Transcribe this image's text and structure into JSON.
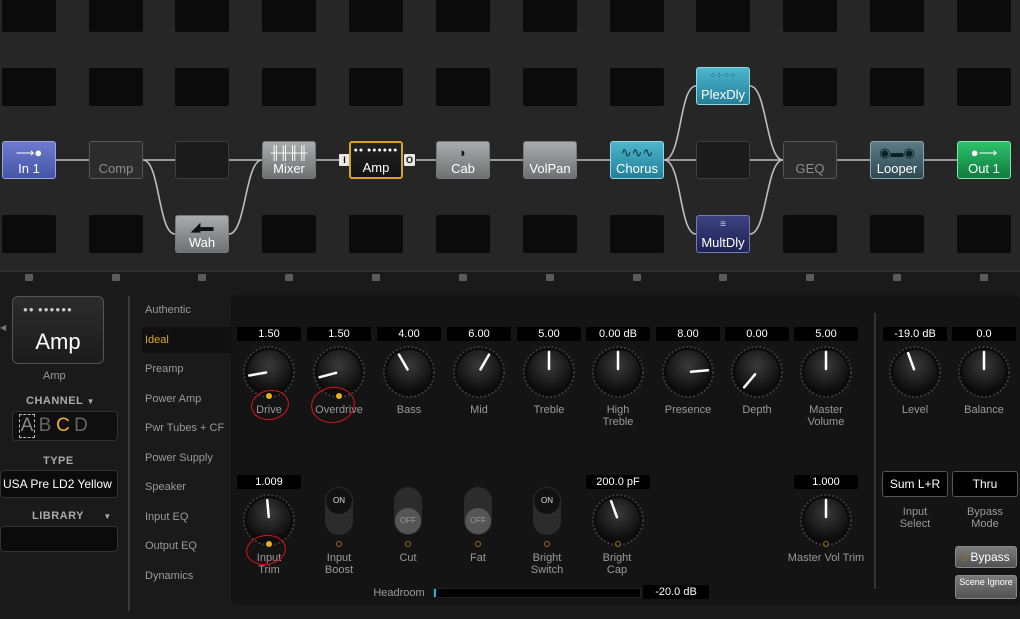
{
  "grid": {
    "blocks": {
      "in": {
        "label": "In 1",
        "icon": "arrow-right-icon"
      },
      "comp": {
        "label": "Comp"
      },
      "wah": {
        "label": "Wah"
      },
      "mixer": {
        "label": "Mixer"
      },
      "amp": {
        "label": "Amp"
      },
      "cab": {
        "label": "Cab"
      },
      "volpan": {
        "label": "VolPan"
      },
      "chorus": {
        "label": "Chorus"
      },
      "plexdly": {
        "label": "PlexDly"
      },
      "multdly": {
        "label": "MultDly"
      },
      "geq": {
        "label": "GEQ"
      },
      "looper": {
        "label": "Looper"
      },
      "out": {
        "label": "Out 1",
        "icon": "arrow-right-icon"
      }
    },
    "amp_in_port": "I",
    "amp_out_port": "O"
  },
  "left": {
    "tile_label": "Amp",
    "tile_caption": "Amp",
    "channel_heading": "CHANNEL",
    "channels": [
      "A",
      "B",
      "C",
      "D"
    ],
    "selected_channel": "C",
    "type_heading": "TYPE",
    "type_value": "USA Pre LD2 Yellow",
    "library_heading": "LIBRARY",
    "library_value": ""
  },
  "menu": {
    "items": [
      "Authentic",
      "Ideal",
      "Preamp",
      "Power Amp",
      "Pwr Tubes + CF",
      "Power Supply",
      "Speaker",
      "Input EQ",
      "Output EQ",
      "Dynamics"
    ],
    "selected": "Ideal"
  },
  "params": {
    "drive": {
      "value": "1.50",
      "label": "Drive",
      "led": true
    },
    "overdrive": {
      "value": "1.50",
      "label": "Overdrive",
      "led": true
    },
    "bass": {
      "value": "4.00",
      "label": "Bass"
    },
    "mid": {
      "value": "6.00",
      "label": "Mid"
    },
    "treble": {
      "value": "5.00",
      "label": "Treble"
    },
    "high_treble": {
      "value": "0.00 dB",
      "label": "High Treble"
    },
    "presence": {
      "value": "8.00",
      "label": "Presence"
    },
    "depth": {
      "value": "0.00",
      "label": "Depth"
    },
    "master_volume": {
      "value": "5.00",
      "label": "Master Volume"
    },
    "level": {
      "value": "-19.0 dB",
      "label": "Level"
    },
    "balance": {
      "value": "0.0",
      "label": "Balance"
    },
    "input_trim": {
      "value": "1.009",
      "label": "Input Trim",
      "led": true
    },
    "input_boost": {
      "state": "ON",
      "label": "Input Boost"
    },
    "cut": {
      "state": "OFF",
      "label": "Cut"
    },
    "fat": {
      "state": "OFF",
      "label": "Fat"
    },
    "bright_switch": {
      "state": "ON",
      "label": "Bright Switch"
    },
    "bright_cap": {
      "value": "200.0 pF",
      "label": "Bright Cap"
    },
    "master_vol_trim": {
      "value": "1.000",
      "label": "Master Vol Trim"
    },
    "input_select": {
      "value": "Sum L+R",
      "label": "Input Select"
    },
    "bypass_mode": {
      "value": "Thru",
      "label": "Bypass Mode"
    },
    "bypass_button": "Bypass",
    "scene_ignore_button": "Scene Ignore",
    "headroom": {
      "label": "Headroom",
      "value": "-20.0 dB"
    }
  },
  "colors": {
    "accent": "#e9b11e",
    "annotation": "#d8141a"
  }
}
